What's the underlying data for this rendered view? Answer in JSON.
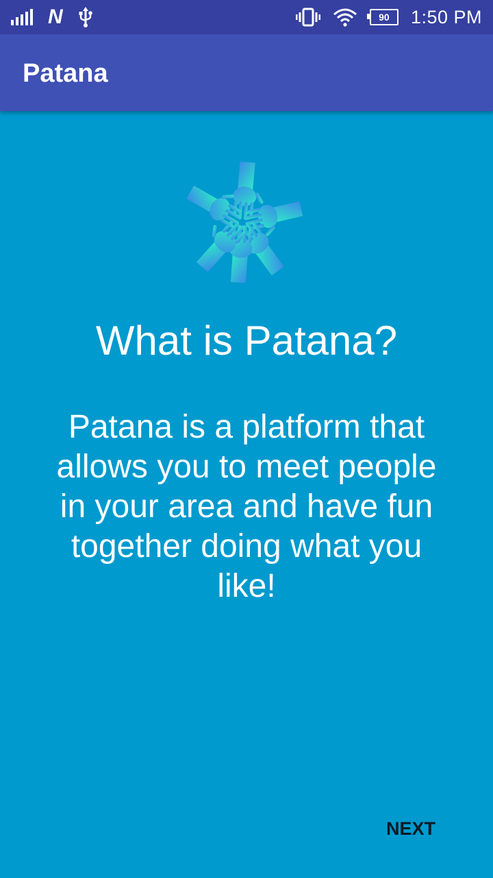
{
  "status_bar": {
    "time": "1:50 PM",
    "battery_level": "90",
    "network_icon_label": "N",
    "icons": [
      "signal-icon",
      "network-icon",
      "usb-icon",
      "vibrate-icon",
      "wifi-icon",
      "battery-icon"
    ]
  },
  "app_bar": {
    "title": "Patana"
  },
  "onboarding": {
    "logo_icon": "hands-circle-icon",
    "heading": "What is Patana?",
    "description": "Patana is a platform that allows you to meet people in your area and have fun together doing what you like!"
  },
  "actions": {
    "next_label": "NEXT"
  },
  "colors": {
    "status_bar": "#3540A0",
    "app_bar": "#3F51B5",
    "background": "#009ACE",
    "logo_gradient_start": "#3A8CE8",
    "logo_gradient_end": "#2EE6C8"
  }
}
